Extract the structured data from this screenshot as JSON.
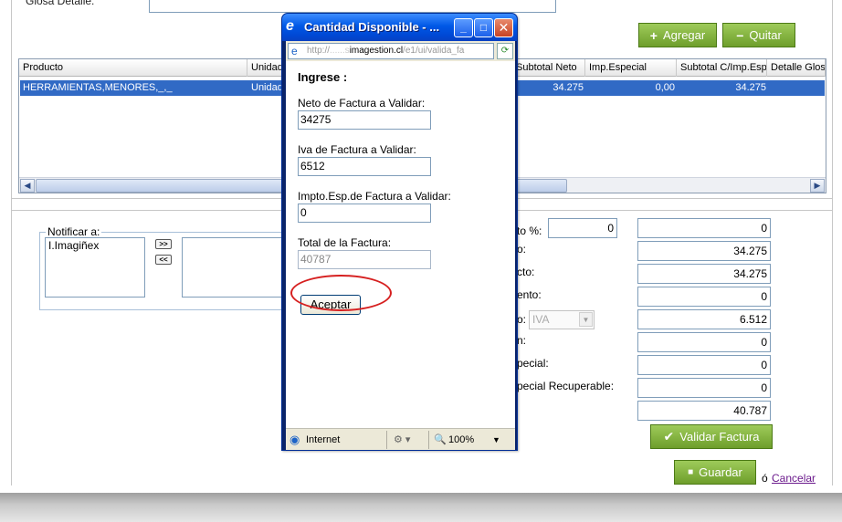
{
  "page": {
    "glosa_label": "Glosa Detalle:",
    "buttons": {
      "add": "Agregar",
      "remove": "Quitar"
    },
    "grid": {
      "columns": [
        "Producto",
        "Unidad",
        "Subtotal Neto",
        "Imp.Especial",
        "Subtotal C/Imp.Esp",
        "Detalle Glosa"
      ],
      "row": {
        "producto": "HERRAMIENTAS,MENORES,_,_",
        "unidad": "Unidad",
        "subtotal_neto": "34.275",
        "imp_especial": "0,00",
        "subtotal_c_imp": "34.275"
      }
    },
    "notify": {
      "legend": "Notificar a:",
      "items": [
        "I.Imagiñex"
      ],
      "move_right": ">>",
      "move_left": "<<"
    },
    "totals": {
      "labels": [
        "to %:",
        "o:",
        "cto:",
        "ento:",
        "o:",
        "n:",
        "pecial:",
        "pecial Recuperable:"
      ],
      "discount_pct": "0",
      "tax_select": "IVA",
      "values": [
        "0",
        "34.275",
        "34.275",
        "0",
        "6.512",
        "0",
        "0",
        "0",
        "40.787"
      ]
    },
    "validate_button": "Validar Factura",
    "save_button": "Guardar",
    "or_text": "ó",
    "cancel_link": "Cancelar"
  },
  "popup": {
    "title": "Cantidad Disponible - ...",
    "url_prefix": "http://",
    "url_hidden": "......s",
    "url_domain": "imagestion.cl",
    "url_path": "/e1/ui/valida_fa",
    "heading": "Ingrese :",
    "fields": [
      {
        "label": "Neto de Factura a Validar:",
        "value": "34275"
      },
      {
        "label": "Iva de Factura a Validar:",
        "value": "6512"
      },
      {
        "label": "Impto.Esp.de Factura a Validar:",
        "value": "0"
      },
      {
        "label": "Total de la Factura:",
        "value": "40787"
      }
    ],
    "accept_button": "Aceptar",
    "status": {
      "zone": "Internet",
      "zoom": "100%"
    }
  },
  "colors": {
    "highlight_row": "#316ac5",
    "green_button": "#6e9e2b",
    "annotation": "#d62020",
    "titlebar": "#0058e6"
  }
}
